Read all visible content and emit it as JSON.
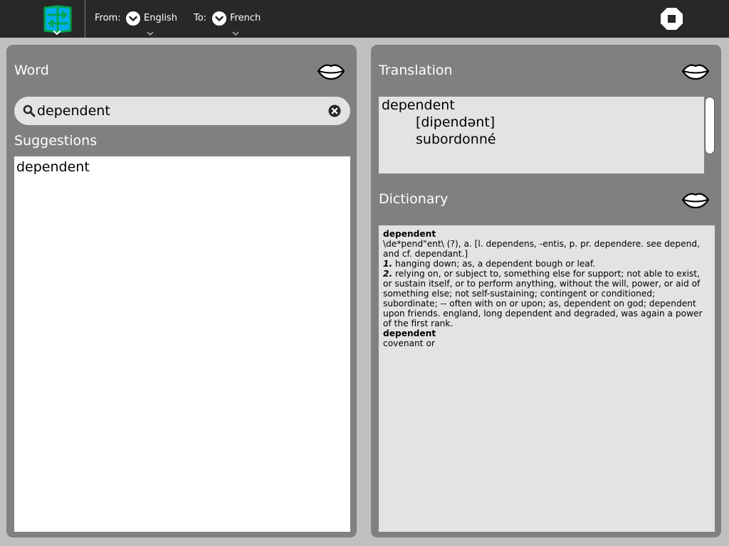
{
  "toolbar": {
    "from_label": "From:",
    "from_value": "English",
    "to_label": "To:",
    "to_value": "French",
    "activity_icon": "book-translate-icon",
    "stop_icon": "stop-icon"
  },
  "word_panel": {
    "title": "Word",
    "search": {
      "value": "dependent"
    },
    "suggestions_title": "Suggestions",
    "suggestions": [
      "dependent"
    ]
  },
  "translation_panel": {
    "title": "Translation",
    "word": "dependent",
    "pronunciation": "[dipendənt]",
    "meaning": "subordonné"
  },
  "dictionary_panel": {
    "title": "Dictionary",
    "entry1_headword": "dependent",
    "entry1_etymology": "\\de*pend\"ent\\ (?), a. [l. dependens, -entis, p. pr. dependere. see depend, and cf. dependant.]",
    "sense1_number": "1.",
    "sense1_text": " hanging down; as, a dependent bough or leaf.",
    "sense2_number": "2.",
    "sense2_text": " relying on, or subject to, something else for support; not able to exist, or sustain itself, or to perform anything, without the will, power, or aid of something else; not self-sustaining; contingent or conditioned; subordinate; -- often with on or upon; as, dependent on god; dependent upon friends. england, long dependent and degraded, was again a power of the first rank.",
    "entry2_headword": "dependent",
    "entry2_text": "covenant or"
  },
  "colors": {
    "toolbar_bg": "#282828",
    "panel_bg": "#808080",
    "page_bg": "#c0c0c0",
    "field_bg": "#e3e3e3",
    "activity_green": "#00a651",
    "activity_blue": "#00aeef"
  }
}
